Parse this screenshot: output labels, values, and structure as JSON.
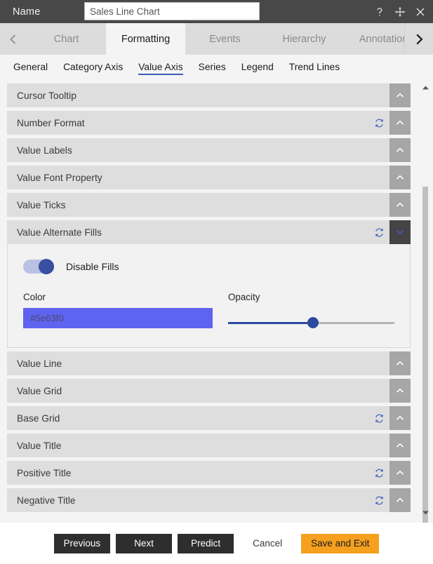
{
  "titlebar": {
    "name_label": "Name",
    "name_value": "Sales Line Chart",
    "name_placeholder": "Name",
    "icons": [
      "help-icon",
      "move-icon",
      "close-icon"
    ]
  },
  "tabs": {
    "prev_arrow": "chevron-left-icon",
    "next_arrow": "chevron-right-icon",
    "items": [
      {
        "label": "Chart",
        "active": false
      },
      {
        "label": "Formatting",
        "active": true
      },
      {
        "label": "Events",
        "active": false
      },
      {
        "label": "Hierarchy",
        "active": false
      },
      {
        "label": "Annotation",
        "active": false
      }
    ]
  },
  "subtabs": {
    "items": [
      {
        "label": "General",
        "active": false
      },
      {
        "label": "Category Axis",
        "active": false
      },
      {
        "label": "Value Axis",
        "active": true
      },
      {
        "label": "Series",
        "active": false
      },
      {
        "label": "Legend",
        "active": false
      },
      {
        "label": "Trend Lines",
        "active": false
      }
    ],
    "accent_color": "#3d5dbb"
  },
  "sections": [
    {
      "title": "Cursor Tooltip",
      "reset": false,
      "expanded": false
    },
    {
      "title": "Number Format",
      "reset": true,
      "expanded": false
    },
    {
      "title": "Value Labels",
      "reset": false,
      "expanded": false
    },
    {
      "title": "Value Font Property",
      "reset": false,
      "expanded": false
    },
    {
      "title": "Value Ticks",
      "reset": false,
      "expanded": false
    },
    {
      "title": "Value Alternate Fills",
      "reset": true,
      "expanded": true
    },
    {
      "title": "Value Line",
      "reset": false,
      "expanded": false
    },
    {
      "title": "Value Grid",
      "reset": false,
      "expanded": false
    },
    {
      "title": "Base Grid",
      "reset": true,
      "expanded": false
    },
    {
      "title": "Value Title",
      "reset": false,
      "expanded": false
    },
    {
      "title": "Positive Title",
      "reset": true,
      "expanded": false
    },
    {
      "title": "Negative Title",
      "reset": true,
      "expanded": false
    }
  ],
  "alternate_fills": {
    "toggle_label": "Disable Fills",
    "toggle_on": true,
    "color_label": "Color",
    "color_value": "#5e63f0",
    "color_swatch": "#5e63f0",
    "opacity_label": "Opacity",
    "opacity_percent": 51
  },
  "scrollbar": {
    "up_arrow": "triangle-up-icon",
    "down_arrow": "triangle-down-icon"
  },
  "footer": {
    "buttons": [
      {
        "label": "Previous",
        "style": "dark"
      },
      {
        "label": "Next",
        "style": "dark"
      },
      {
        "label": "Predict",
        "style": "dark"
      },
      {
        "label": "Cancel",
        "style": "light"
      },
      {
        "label": "Save and Exit",
        "style": "accent"
      }
    ],
    "accent_color": "#f5a01e"
  }
}
